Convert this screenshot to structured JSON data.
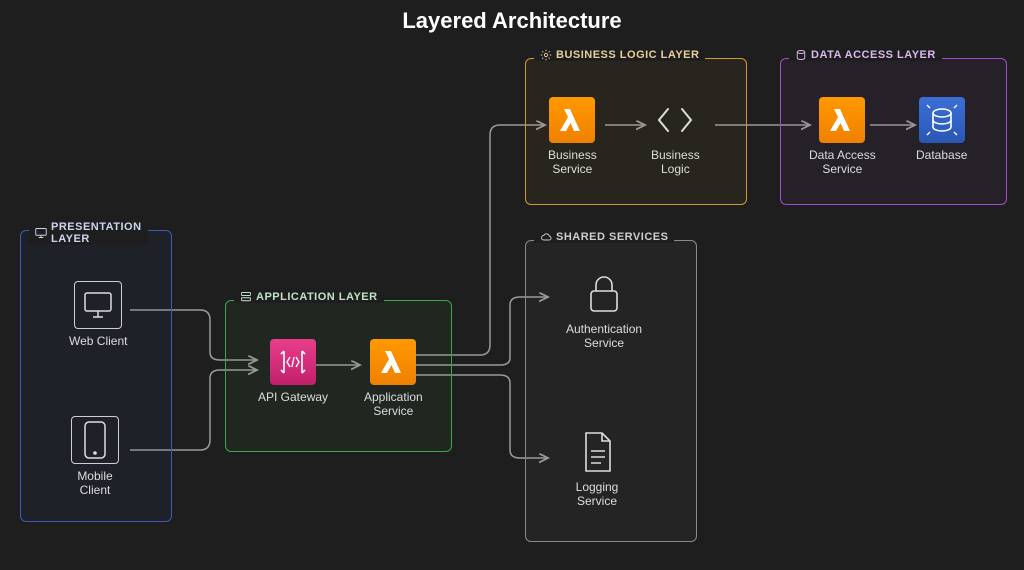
{
  "title": "Layered Architecture",
  "layers": {
    "presentation": {
      "label": "PRESENTATION\nLAYER",
      "color": "#3b5bb5"
    },
    "application": {
      "label": "APPLICATION LAYER",
      "color": "#3fa34d"
    },
    "business": {
      "label": "BUSINESS LOGIC LAYER",
      "color": "#d29a2e"
    },
    "dataaccess": {
      "label": "DATA ACCESS LAYER",
      "color": "#a24bd1"
    },
    "shared": {
      "label": "SHARED SERVICES",
      "color": "#9e9e9e"
    }
  },
  "nodes": {
    "web_client": {
      "label": "Web Client"
    },
    "mobile_client": {
      "label": "Mobile\nClient"
    },
    "api_gateway": {
      "label": "API Gateway"
    },
    "app_service": {
      "label": "Application\nService"
    },
    "biz_service": {
      "label": "Business\nService"
    },
    "biz_logic": {
      "label": "Business\nLogic"
    },
    "da_service": {
      "label": "Data Access\nService"
    },
    "database": {
      "label": "Database"
    },
    "auth_service": {
      "label": "Authentication\nService"
    },
    "log_service": {
      "label": "Logging\nService"
    }
  }
}
